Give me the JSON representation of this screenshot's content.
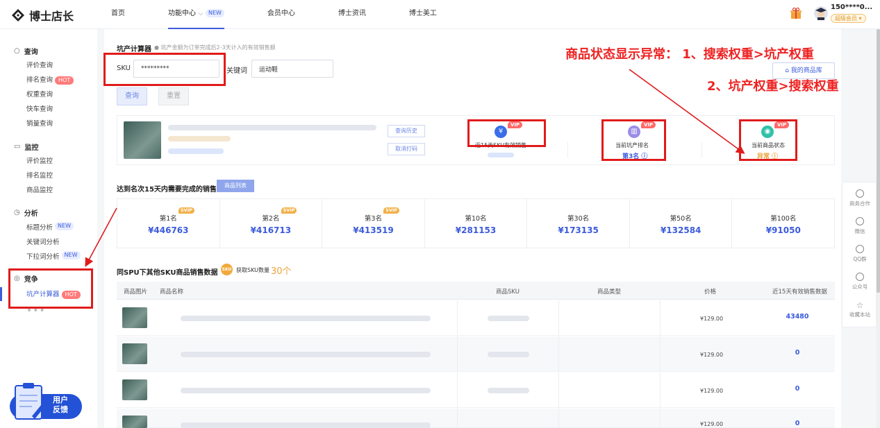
{
  "brand": {
    "name": "博士店长"
  },
  "nav": [
    {
      "label": "首页"
    },
    {
      "label": "功能中心",
      "badge": "NEW",
      "active": true
    },
    {
      "label": "会员中心"
    },
    {
      "label": "博士资讯"
    },
    {
      "label": "博士美工"
    }
  ],
  "user": {
    "name": "150****0...",
    "level": "超级会员 ▾"
  },
  "sidebar": {
    "groups": [
      {
        "title": "查询",
        "items": [
          "评价查询",
          "排名查询",
          "权重查询",
          "快车查询",
          "销量查询"
        ]
      },
      {
        "title": "监控",
        "items": [
          "评价监控",
          "排名监控",
          "商品监控"
        ]
      },
      {
        "title": "分析",
        "items": [
          "标题分析",
          "关键词分析",
          "下拉词分析"
        ]
      },
      {
        "title": "竞争",
        "items": [
          "坑产计算器"
        ]
      }
    ],
    "badges": {
      "hot": "HOT",
      "new": "NEW"
    },
    "feedback": "用户 反馈"
  },
  "calculator": {
    "title": "坑产计算器",
    "hint": "坑产金额为订单完成后2-3天计入的有效销售额",
    "sku_label": "SKU",
    "sku_value": "*********",
    "keyword_label": "关键词",
    "keyword_value": "运动鞋",
    "query_btn": "查询",
    "reset_btn": "重置",
    "mylib_btn": "我的商品库"
  },
  "product": {
    "history_btn": "查询历史",
    "untrack_btn": "取消打码",
    "stats": [
      {
        "label": "近15天SKU有效销售",
        "value": "",
        "vip": "VIP",
        "icon": "¥"
      },
      {
        "label": "当前坑产排名",
        "value": "第3名 ⓘ",
        "vip": "VIP",
        "icon": "▥"
      },
      {
        "label": "当前商品状态",
        "value": "异常 ⓘ",
        "vip": "VIP",
        "icon": "◉"
      }
    ]
  },
  "annotation": {
    "line1": "商品状态显示异常： 1、搜索权重>坑产权重",
    "line2": "2、坑产权重>搜索权重"
  },
  "ranks_section": {
    "title": "达到名次15天内需要完成的销售",
    "list_btn": "商品列表",
    "items": [
      {
        "name": "第1名",
        "value": "¥446763",
        "badge": "SVIP"
      },
      {
        "name": "第2名",
        "value": "¥416713",
        "badge": "SVIP"
      },
      {
        "name": "第3名",
        "value": "¥413519",
        "badge": "SVIP"
      },
      {
        "name": "第10名",
        "value": "¥281153",
        "badge": ""
      },
      {
        "name": "第30名",
        "value": "¥173135",
        "badge": ""
      },
      {
        "name": "第50名",
        "value": "¥132584",
        "badge": ""
      },
      {
        "name": "第100名",
        "value": "¥91050",
        "badge": ""
      }
    ]
  },
  "spu_section": {
    "title": "同SPU下其他SKU商品销售数据",
    "chip": "SKU",
    "count_label": "获取SKU数量",
    "count": "30个",
    "headers": [
      "商品图片",
      "商品名称",
      "商品SKU",
      "商品类型",
      "价格",
      "近15天有效销售数据"
    ],
    "rows": [
      {
        "price": "¥129.00",
        "sales": "43480"
      },
      {
        "price": "¥129.00",
        "sales": "0"
      },
      {
        "price": "¥129.00",
        "sales": "0"
      },
      {
        "price": "¥129.00",
        "sales": "0"
      }
    ]
  },
  "right_panel": [
    "商务合作",
    "微信",
    "QQ群",
    "公众号",
    "收藏本站"
  ],
  "colors": {
    "primary": "#3b5bdb",
    "annotation": "#ee2222",
    "warning": "#e8a23a",
    "hot": "#ff7a7a"
  }
}
